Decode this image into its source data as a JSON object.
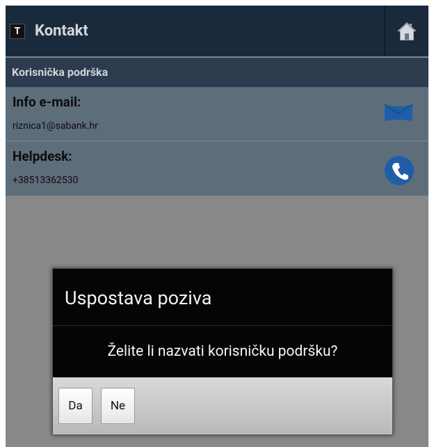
{
  "app": {
    "icon_letter": "T",
    "title": "Kontakt"
  },
  "section": {
    "title": "Korisnička podrška"
  },
  "contacts": [
    {
      "label": "Info e-mail:",
      "value": "riznica1@sabank.hr",
      "icon": "envelope-icon"
    },
    {
      "label": "Helpdesk:",
      "value": "+38513362530",
      "icon": "phone-icon"
    }
  ],
  "dialog": {
    "title": "Uspostava poziva",
    "message": "Želite li nazvati korisničku podršku?",
    "buttons": {
      "yes": "Da",
      "no": "Ne"
    }
  },
  "colors": {
    "actionbar": "#1a2a3d",
    "section_header": "#2d3b4e",
    "accent_blue": "#1e5ea8"
  }
}
